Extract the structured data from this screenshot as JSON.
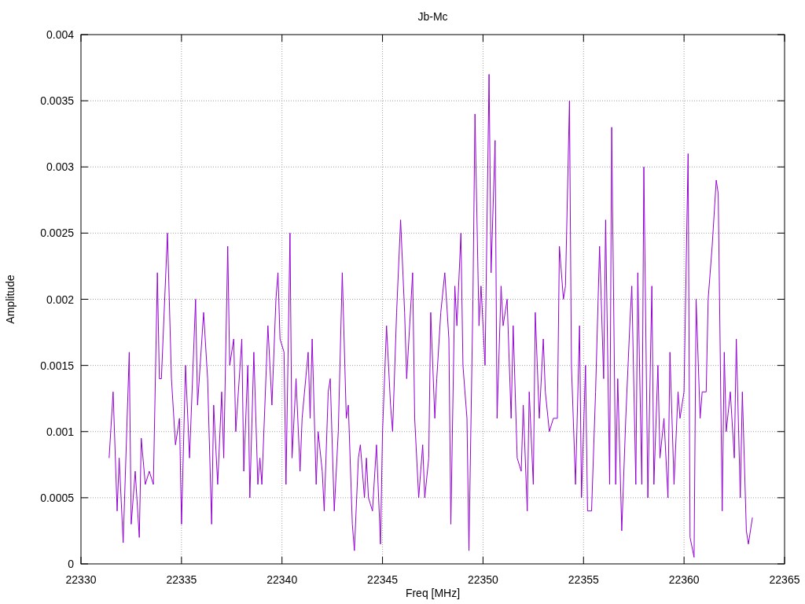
{
  "chart_data": {
    "type": "line",
    "title": "Jb-Mc",
    "xlabel": "Freq [MHz]",
    "ylabel": "Amplitude",
    "xlim": [
      22330,
      22365
    ],
    "ylim": [
      0,
      0.004
    ],
    "grid": true,
    "xticks": [
      22330,
      22335,
      22340,
      22345,
      22350,
      22355,
      22360,
      22365
    ],
    "yticks": [
      0,
      0.0005,
      0.001,
      0.0015,
      0.002,
      0.0025,
      0.003,
      0.0035,
      0.004
    ],
    "x": [
      22331.4,
      22331.6,
      22331.8,
      22331.9,
      22332.1,
      22332.4,
      22332.5,
      22332.7,
      22332.9,
      22333.0,
      22333.2,
      22333.4,
      22333.6,
      22333.8,
      22333.9,
      22334.0,
      22334.3,
      22334.5,
      22334.7,
      22334.9,
      22335.0,
      22335.2,
      22335.4,
      22335.7,
      22335.8,
      22336.1,
      22336.3,
      22336.5,
      22336.6,
      22336.8,
      22337.0,
      22337.1,
      22337.3,
      22337.4,
      22337.6,
      22337.7,
      22338.0,
      22338.1,
      22338.3,
      22338.4,
      22338.6,
      22338.8,
      22338.9,
      22339.0,
      22339.3,
      22339.5,
      22339.7,
      22339.8,
      22339.9,
      22340.1,
      22340.2,
      22340.4,
      22340.5,
      22340.7,
      22340.9,
      22341.0,
      22341.3,
      22341.4,
      22341.5,
      22341.7,
      22341.8,
      22342.0,
      22342.1,
      22342.3,
      22342.4,
      22342.6,
      22342.8,
      22343.0,
      22343.2,
      22343.3,
      22343.5,
      22343.6,
      22343.8,
      22343.9,
      22344.1,
      22344.2,
      22344.3,
      22344.5,
      22344.7,
      22344.9,
      22345.0,
      22345.2,
      22345.4,
      22345.5,
      22345.7,
      22345.9,
      22346.1,
      22346.2,
      22346.5,
      22346.6,
      22346.8,
      22347.0,
      22347.1,
      22347.3,
      22347.4,
      22347.6,
      22347.7,
      22347.9,
      22348.1,
      22348.3,
      22348.4,
      22348.6,
      22348.7,
      22348.9,
      22349.0,
      22349.2,
      22349.3,
      22349.5,
      22349.6,
      22349.8,
      22349.9,
      22350.1,
      22350.3,
      22350.4,
      22350.6,
      22350.7,
      22350.9,
      22351.0,
      22351.2,
      22351.4,
      22351.5,
      22351.7,
      22351.9,
      22352.0,
      22352.2,
      22352.3,
      22352.5,
      22352.6,
      22352.8,
      22353.0,
      22353.1,
      22353.3,
      22353.5,
      22353.7,
      22353.8,
      22354.0,
      22354.1,
      22354.3,
      22354.4,
      22354.6,
      22354.8,
      22354.9,
      22355.1,
      22355.2,
      22355.4,
      22355.6,
      22355.8,
      22356.0,
      22356.1,
      22356.3,
      22356.4,
      22356.6,
      22356.7,
      22356.9,
      22357.1,
      22357.3,
      22357.4,
      22357.6,
      22357.7,
      22357.9,
      22358.0,
      22358.2,
      22358.4,
      22358.5,
      22358.7,
      22358.8,
      22359.0,
      22359.2,
      22359.3,
      22359.5,
      22359.7,
      22359.8,
      22360.0,
      22360.2,
      22360.3,
      22360.5,
      22360.6,
      22360.8,
      22360.9,
      22361.1,
      22361.2,
      22361.4,
      22361.6,
      22361.7,
      22361.9,
      22362.0,
      22362.1,
      22362.3,
      22362.5,
      22362.6,
      22362.8,
      22362.9,
      22363.1,
      22363.2,
      22363.4
    ],
    "series": [
      {
        "color": "#9400d3",
        "values": [
          0.0008,
          0.0013,
          0.0004,
          0.0008,
          0.00016,
          0.0016,
          0.0003,
          0.0007,
          0.0002,
          0.00095,
          0.0006,
          0.0007,
          0.0006,
          0.0022,
          0.0014,
          0.0014,
          0.0025,
          0.0014,
          0.0009,
          0.0011,
          0.0003,
          0.0015,
          0.0008,
          0.002,
          0.0012,
          0.0019,
          0.0014,
          0.0003,
          0.0012,
          0.0006,
          0.0013,
          0.0008,
          0.0024,
          0.0015,
          0.0017,
          0.001,
          0.0017,
          0.0007,
          0.0015,
          0.0005,
          0.0016,
          0.0006,
          0.0008,
          0.0006,
          0.0018,
          0.0012,
          0.002,
          0.0022,
          0.0017,
          0.0016,
          0.0006,
          0.0025,
          0.0008,
          0.0014,
          0.0007,
          0.0011,
          0.0016,
          0.0011,
          0.0017,
          0.0006,
          0.001,
          0.0007,
          0.0004,
          0.0013,
          0.0014,
          0.0004,
          0.001,
          0.0022,
          0.0011,
          0.0012,
          0.0003,
          0.0001,
          0.0008,
          0.0009,
          0.0005,
          0.0008,
          0.0005,
          0.0004,
          0.0009,
          0.00015,
          0.001,
          0.0018,
          0.0012,
          0.001,
          0.0019,
          0.0026,
          0.0019,
          0.0014,
          0.0022,
          0.0011,
          0.0005,
          0.0009,
          0.0005,
          0.0008,
          0.0019,
          0.0011,
          0.0014,
          0.0019,
          0.0022,
          0.0017,
          0.0003,
          0.0021,
          0.0018,
          0.0025,
          0.0015,
          0.0011,
          0.0001,
          0.002,
          0.0034,
          0.0018,
          0.0021,
          0.0015,
          0.0037,
          0.0022,
          0.0032,
          0.0011,
          0.0021,
          0.0018,
          0.002,
          0.0011,
          0.0018,
          0.0008,
          0.0007,
          0.0012,
          0.0004,
          0.0013,
          0.0006,
          0.0019,
          0.0011,
          0.0017,
          0.0013,
          0.001,
          0.0011,
          0.0011,
          0.0024,
          0.002,
          0.0021,
          0.0035,
          0.0015,
          0.0006,
          0.0018,
          0.0005,
          0.0015,
          0.0004,
          0.0004,
          0.0013,
          0.0024,
          0.0014,
          0.0026,
          0.0006,
          0.0033,
          0.0006,
          0.0014,
          0.00025,
          0.0011,
          0.0018,
          0.0021,
          0.0006,
          0.0022,
          0.0006,
          0.003,
          0.0005,
          0.0021,
          0.0006,
          0.0015,
          0.0008,
          0.0011,
          0.0005,
          0.0016,
          0.0006,
          0.0013,
          0.0011,
          0.0013,
          0.0031,
          0.0002,
          5e-05,
          0.002,
          0.0011,
          0.0013,
          0.0013,
          0.002,
          0.0024,
          0.0029,
          0.0028,
          0.0004,
          0.0016,
          0.001,
          0.0013,
          0.0008,
          0.0017,
          0.0005,
          0.0013,
          0.00025,
          0.00015,
          0.00035
        ]
      }
    ]
  }
}
